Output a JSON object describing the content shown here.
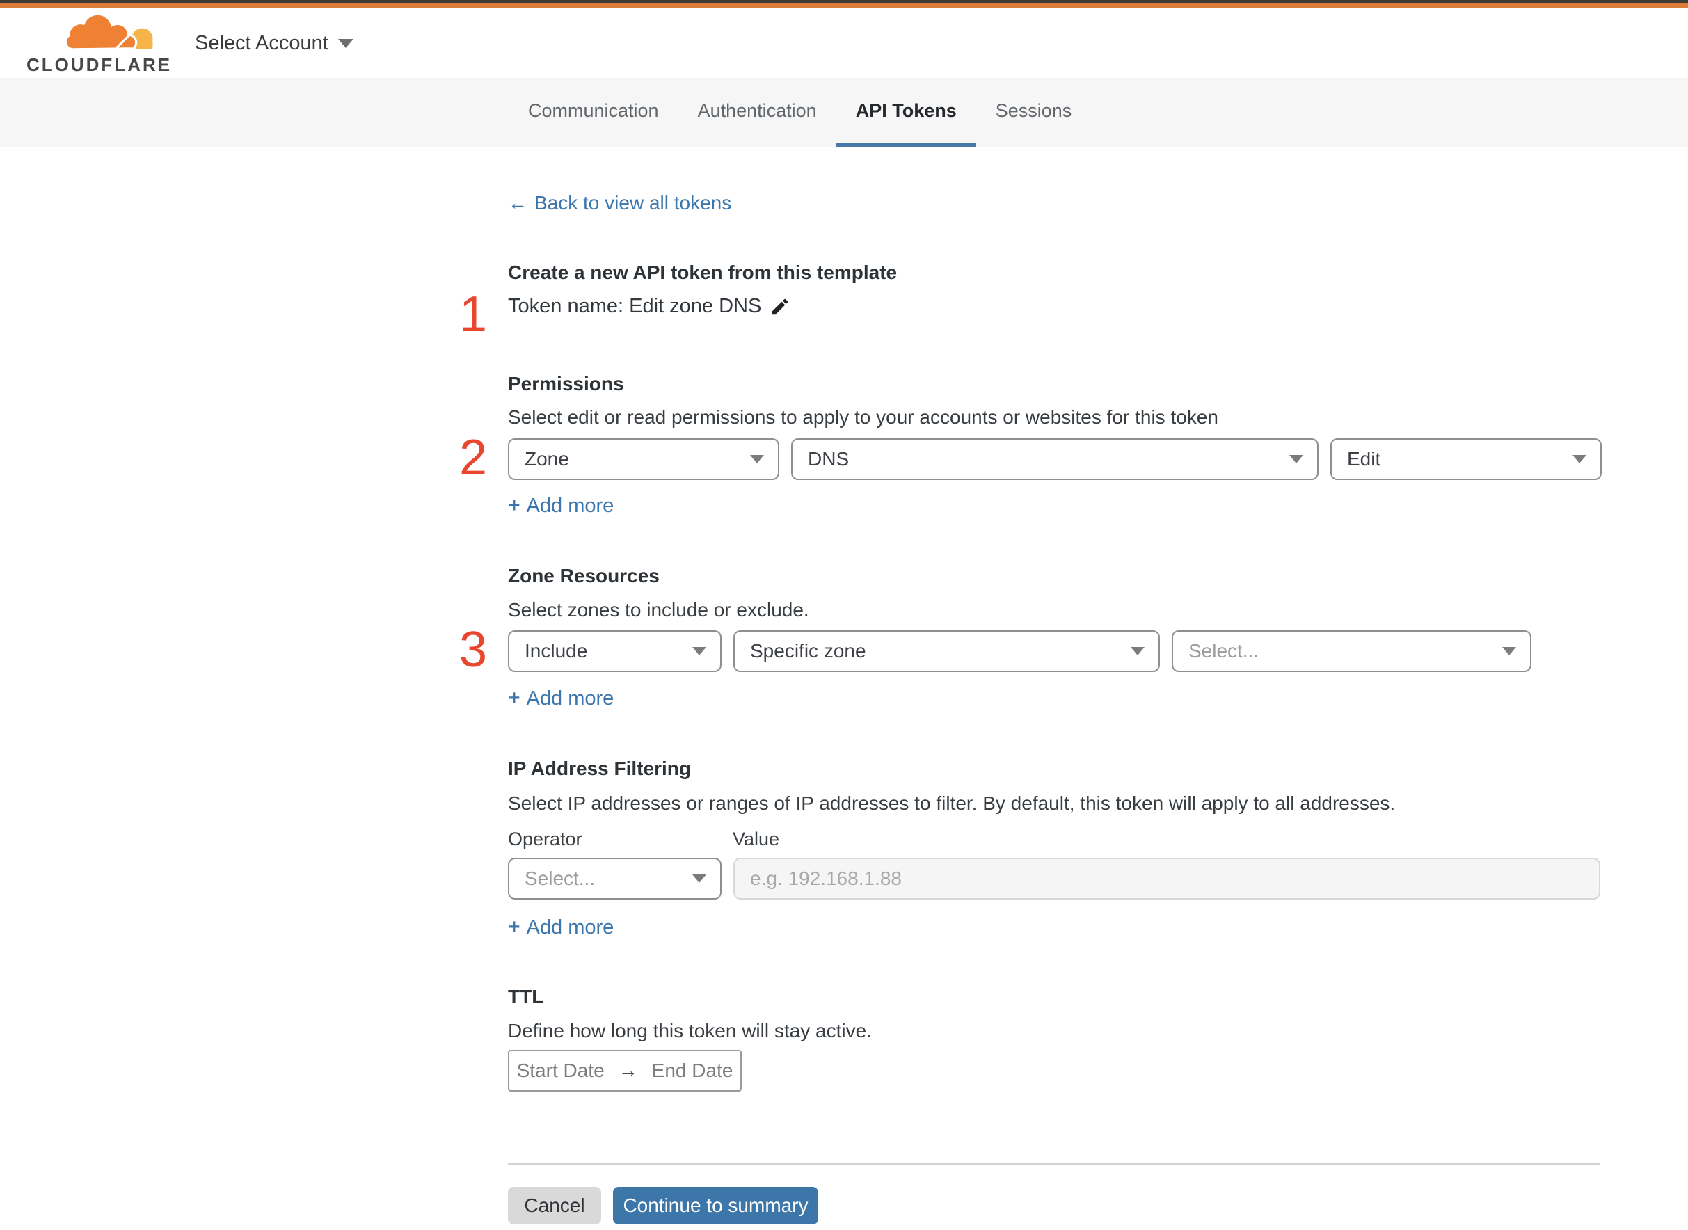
{
  "header": {
    "logo_text": "CLOUDFLARE",
    "account_selector_label": "Select Account"
  },
  "tabs": {
    "communication": "Communication",
    "authentication": "Authentication",
    "api_tokens": "API Tokens",
    "sessions": "Sessions"
  },
  "icons": {
    "back_arrow": "←",
    "range_arrow": "→",
    "plus": "+"
  },
  "page": {
    "back_link": "Back to view all tokens",
    "title": "Create a new API token from this template",
    "token_name": "Token name: Edit zone DNS",
    "step_markers": {
      "one": "1",
      "two": "2",
      "three": "3"
    }
  },
  "permissions": {
    "heading": "Permissions",
    "description": "Select edit or read permissions to apply to your accounts or websites for this token",
    "scope_value": "Zone",
    "resource_value": "DNS",
    "access_value": "Edit",
    "add_more": "Add more"
  },
  "zone_resources": {
    "heading": "Zone Resources",
    "description": "Select zones to include or exclude.",
    "mode_value": "Include",
    "type_value": "Specific zone",
    "zone_placeholder": "Select...",
    "add_more": "Add more"
  },
  "ip_filtering": {
    "heading": "IP Address Filtering",
    "description": "Select IP addresses or ranges of IP addresses to filter. By default, this token will apply to all addresses.",
    "operator_label": "Operator",
    "value_label": "Value",
    "operator_placeholder": "Select...",
    "value_placeholder": "e.g. 192.168.1.88",
    "add_more": "Add more"
  },
  "ttl": {
    "heading": "TTL",
    "description": "Define how long this token will stay active.",
    "start_date_placeholder": "Start Date",
    "end_date_placeholder": "End Date"
  },
  "footer": {
    "cancel_label": "Cancel",
    "continue_label": "Continue to summary"
  },
  "colors": {
    "brand_orange": "#ee8133",
    "brand_orange_light": "#f6b44b",
    "top_bar_orange": "#dd7b38",
    "step_marker_red": "#e8462d",
    "link_blue": "#3b76ad",
    "primary_button_blue": "#3d76a8",
    "tab_underline_blue": "#4878a8"
  }
}
